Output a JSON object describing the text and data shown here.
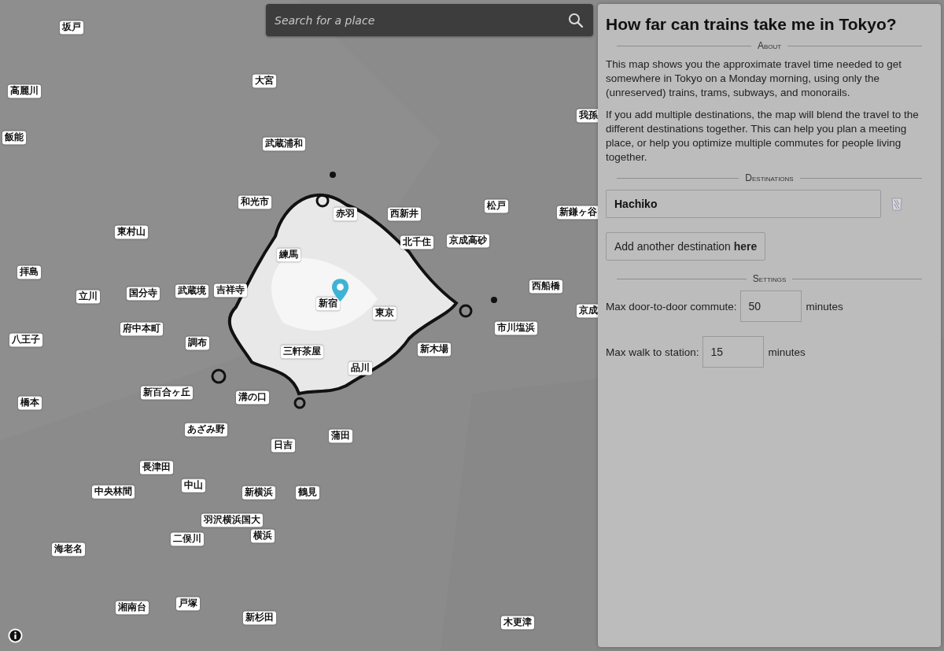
{
  "search": {
    "placeholder": "Search for a place"
  },
  "map": {
    "labels": [
      {
        "text": "坂戸"
      },
      {
        "text": "高麗川"
      },
      {
        "text": "大宮"
      },
      {
        "text": "飯能"
      },
      {
        "text": "武蔵浦和"
      },
      {
        "text": "我孫"
      },
      {
        "text": "和光市"
      },
      {
        "text": "赤羽"
      },
      {
        "text": "西新井"
      },
      {
        "text": "松戸"
      },
      {
        "text": "新鎌ヶ谷"
      },
      {
        "text": "東村山"
      },
      {
        "text": "北千住"
      },
      {
        "text": "京成高砂"
      },
      {
        "text": "練馬"
      },
      {
        "text": "拝島"
      },
      {
        "text": "立川"
      },
      {
        "text": "国分寺"
      },
      {
        "text": "武蔵境"
      },
      {
        "text": "吉祥寺"
      },
      {
        "text": "新宿"
      },
      {
        "text": "東京"
      },
      {
        "text": "西船橋"
      },
      {
        "text": "京成"
      },
      {
        "text": "府中本町"
      },
      {
        "text": "市川塩浜"
      },
      {
        "text": "八王子"
      },
      {
        "text": "調布"
      },
      {
        "text": "三軒茶屋"
      },
      {
        "text": "新木場"
      },
      {
        "text": "品川"
      },
      {
        "text": "新百合ヶ丘"
      },
      {
        "text": "溝の口"
      },
      {
        "text": "橋本"
      },
      {
        "text": "あざみ野"
      },
      {
        "text": "日吉"
      },
      {
        "text": "蒲田"
      },
      {
        "text": "長津田"
      },
      {
        "text": "中山"
      },
      {
        "text": "中央林間"
      },
      {
        "text": "新横浜"
      },
      {
        "text": "鶴見"
      },
      {
        "text": "羽沢横浜国大"
      },
      {
        "text": "横浜"
      },
      {
        "text": "二俣川"
      },
      {
        "text": "海老名"
      },
      {
        "text": "湘南台"
      },
      {
        "text": "戸塚"
      },
      {
        "text": "新杉田"
      },
      {
        "text": "木更津"
      }
    ]
  },
  "panel": {
    "title": "How far can trains take me in Tokyo?",
    "sections": [
      {
        "kind": "text",
        "heading": "About",
        "paragraphs": [
          "This map shows you the approximate travel time needed to get somewhere in Tokyo on a Monday morning, using only the (unreserved) trains, trams, subways, and monorails.",
          "If you add multiple destinations, the map will blend the travel to the different destinations together. This can help you plan a meeting place, or help you optimize multiple commutes for people living together."
        ]
      },
      {
        "kind": "destinations",
        "heading": "Destinations",
        "destinations": [
          {
            "value": "Hachiko"
          }
        ],
        "add_button": "Add another destination **here**"
      },
      {
        "kind": "settings",
        "heading": "Settings",
        "fields": [
          {
            "label": "Max door-to-door commute:",
            "value": "50",
            "unit": "minutes"
          },
          {
            "label": "Max walk to station:",
            "value": "15",
            "unit": "minutes"
          }
        ]
      }
    ]
  }
}
